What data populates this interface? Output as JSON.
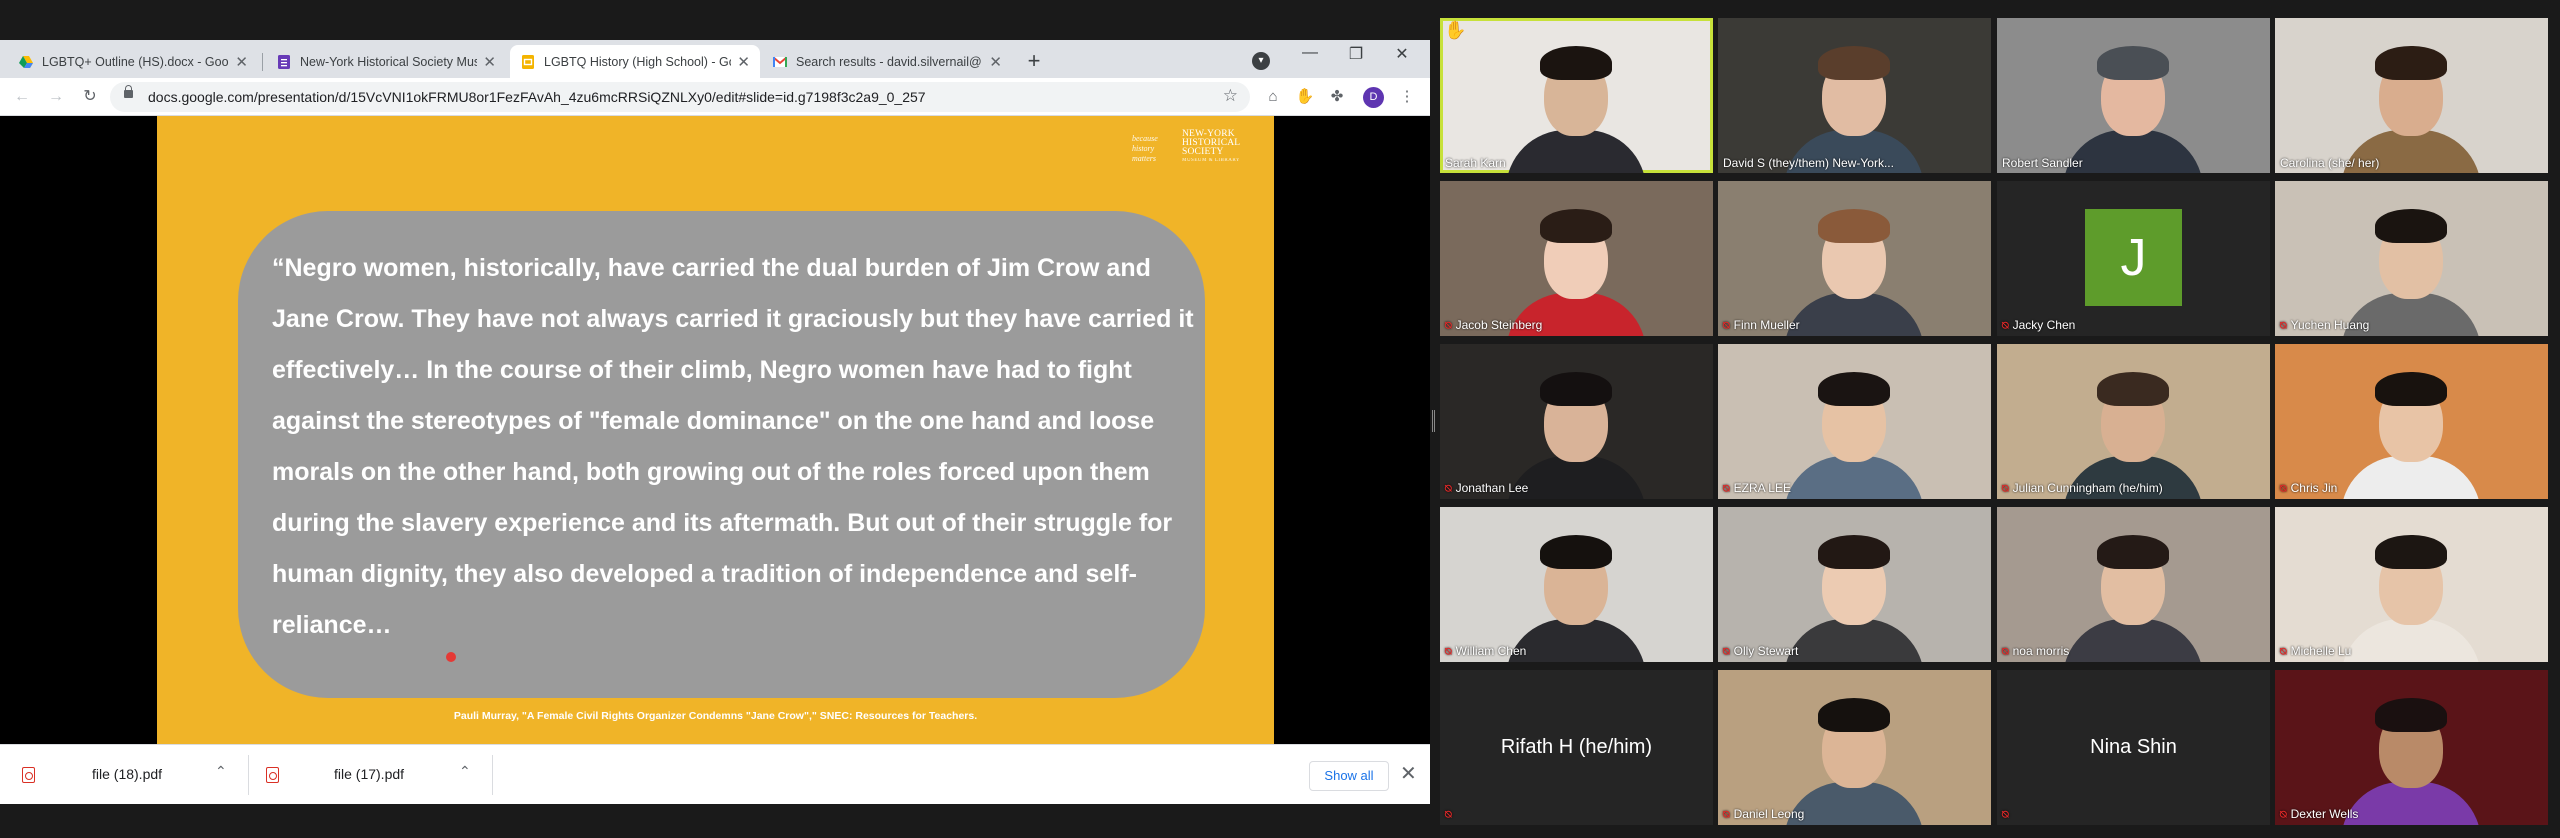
{
  "browser": {
    "tabs": [
      {
        "label": "LGBTQ+ Outline (HS).docx - Goo",
        "icon": "google-drive-icon",
        "active": false
      },
      {
        "label": "New-York Historical Society Mus",
        "icon": "forms-icon",
        "active": false
      },
      {
        "label": "LGBTQ History (High School) - Go",
        "icon": "slides-icon",
        "active": true
      },
      {
        "label": "Search results - david.silvernail@",
        "icon": "gmail-icon",
        "active": false
      }
    ],
    "new_tab": "+",
    "profile_initial": "D",
    "url": "docs.google.com/presentation/d/15VcVNI1okFRMU8or1FezFAvAh_4zu6mcRRSiQZNLXy0/edit#slide=id.g7198f3c2a9_0_257",
    "window_controls": {
      "minimize": "—",
      "restore": "❐",
      "close": "✕"
    }
  },
  "slide": {
    "logo_tagline": "because history matters",
    "logo_name": "NEW-YORK HISTORICAL SOCIETY",
    "logo_sub": "MUSEUM & LIBRARY",
    "quote": "“Negro women, historically, have carried the dual burden of Jim Crow and Jane Crow. They have not always carried it graciously but they have carried it effectively… In the course of their climb, Negro women have had to fight against the stereotypes of \"female dominance\" on the one hand and loose morals on the other hand, both growing out of the roles forced upon them during the slavery experience and its aftermath. But out of their struggle for human dignity, they also developed a tradition of independence and self-reliance…",
    "citation": "Pauli Murray, \"A Female Civil Rights Organizer Condemns \"Jane Crow\",\" SNEC: Resources for Teachers."
  },
  "downloads": {
    "items": [
      {
        "name": "file (18).pdf"
      },
      {
        "name": "file (17).pdf"
      }
    ],
    "show_all": "Show all"
  },
  "gallery": {
    "participants": [
      {
        "name": "Sarah Karn",
        "muted": false,
        "active": true,
        "video": true,
        "bg": "#e9e6e2",
        "skin": "#d8b598",
        "hair": "#1b1410",
        "shirt": "#2a2a30"
      },
      {
        "name": "David S (they/them) New-York...",
        "muted": false,
        "active": false,
        "video": true,
        "bg": "#3b3a36",
        "skin": "#e1bca3",
        "hair": "#5a3e2c",
        "shirt": "#3a4a5a"
      },
      {
        "name": "Robert Sandler",
        "muted": false,
        "active": false,
        "video": true,
        "bg": "#8c8c8c",
        "skin": "#e4b8a0",
        "hair": "#4a4f55",
        "shirt": "#2d3440"
      },
      {
        "name": "Carolina (she/ her)",
        "muted": false,
        "active": false,
        "video": true,
        "bg": "#d8d3cc",
        "skin": "#d9ad8e",
        "hair": "#2c1d14",
        "shirt": "#8a6a44"
      },
      {
        "name": "Jacob Steinberg",
        "muted": true,
        "active": false,
        "video": true,
        "bg": "#7a6a5c",
        "skin": "#f0cdb8",
        "hair": "#2a1d16",
        "shirt": "#c8242c"
      },
      {
        "name": "Finn Mueller",
        "muted": true,
        "active": false,
        "video": true,
        "bg": "#8a7f70",
        "skin": "#eac8b0",
        "hair": "#8a5a3a",
        "shirt": "#3a3f4a"
      },
      {
        "name": "Jacky Chen",
        "muted": true,
        "active": false,
        "video": false,
        "initial": "J"
      },
      {
        "name": "Yuchen Huang",
        "muted": true,
        "active": false,
        "video": true,
        "bg": "#c9c1b6",
        "skin": "#e2c0a4",
        "hair": "#1a1410",
        "shirt": "#6a6a6a"
      },
      {
        "name": "Jonathan Lee",
        "muted": true,
        "active": false,
        "video": true,
        "bg": "#2a2826",
        "skin": "#d9b398",
        "hair": "#141010",
        "shirt": "#1e1e20"
      },
      {
        "name": "EZRA LEE",
        "muted": true,
        "active": false,
        "video": true,
        "bg": "#c9bfb3",
        "skin": "#e6c2a4",
        "hair": "#1a1412",
        "shirt": "#5a6e84"
      },
      {
        "name": "Julian Cunningham (he/him)",
        "muted": true,
        "active": false,
        "video": true,
        "bg": "#c2ad8f",
        "skin": "#d8b092",
        "hair": "#3a2a20",
        "shirt": "#2e3a40"
      },
      {
        "name": "Chris Jin",
        "muted": true,
        "active": false,
        "video": true,
        "bg": "#d88a4a",
        "skin": "#e8c4a6",
        "hair": "#18120e",
        "shirt": "#ededed"
      },
      {
        "name": "William Chen",
        "muted": true,
        "active": false,
        "video": true,
        "bg": "#d6d4d0",
        "skin": "#dab496",
        "hair": "#15110e",
        "shirt": "#2a2a2e"
      },
      {
        "name": "Olly Stewart",
        "muted": true,
        "active": false,
        "video": true,
        "bg": "#b7b3ad",
        "skin": "#eccbb2",
        "hair": "#221814",
        "shirt": "#3a3a3c"
      },
      {
        "name": "noa morris",
        "muted": true,
        "active": false,
        "video": true,
        "bg": "#a59a90",
        "skin": "#e2bea2",
        "hair": "#241a16",
        "shirt": "#3c3c44"
      },
      {
        "name": "Michelle Lu",
        "muted": true,
        "active": false,
        "video": true,
        "bg": "#e4dcd2",
        "skin": "#e6c4a8",
        "hair": "#1c1612",
        "shirt": "#ece6de"
      },
      {
        "name": "Rifath H (he/him)",
        "muted": true,
        "active": false,
        "video": false,
        "big": true
      },
      {
        "name": "Daniel Leong",
        "muted": true,
        "active": false,
        "video": true,
        "bg": "#b9a080",
        "skin": "#dcb596",
        "hair": "#15110e",
        "shirt": "#4a5a6a"
      },
      {
        "name": "Nina Shin",
        "muted": true,
        "active": false,
        "video": false,
        "big": true
      },
      {
        "name": "Dexter Wells",
        "muted": true,
        "active": false,
        "video": true,
        "bg": "#5a1418",
        "skin": "#b98a68",
        "hair": "#1a1010",
        "shirt": "#7a3aa8"
      }
    ]
  },
  "colors": {
    "slide_bg": "#f0b428",
    "quote_box": "#9b9b9b",
    "active_speaker": "#c7e13a",
    "muted_icon": "#e02828",
    "avatar_green": "#5e9c2b"
  }
}
